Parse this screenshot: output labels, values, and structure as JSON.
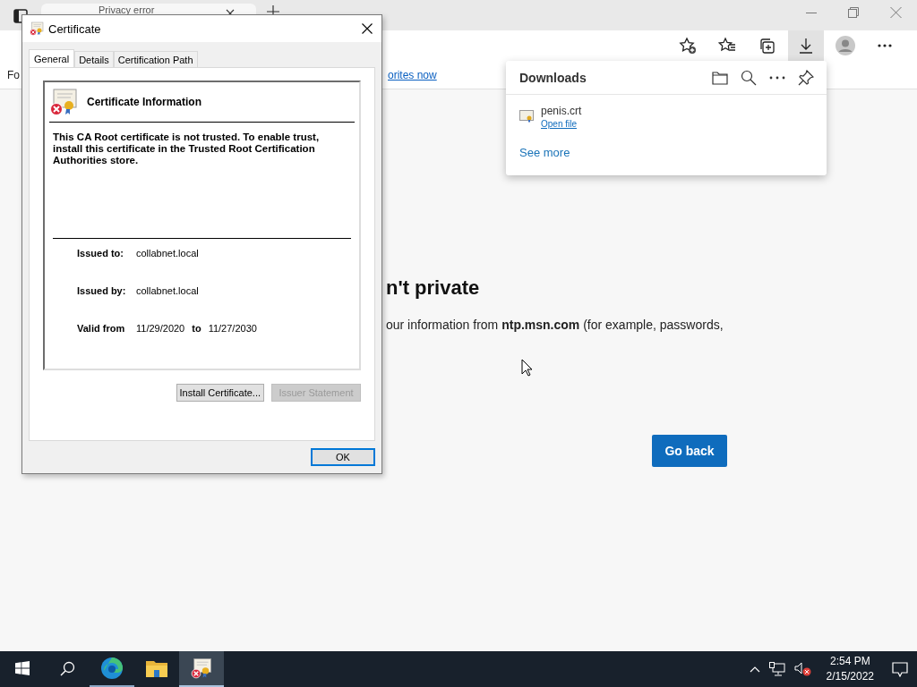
{
  "browser": {
    "tab": {
      "title": "Privacy error"
    },
    "toolbar_buttons": [
      {
        "kind": "add-favorite",
        "selected": false
      },
      {
        "kind": "favorites",
        "selected": false
      },
      {
        "kind": "collections",
        "selected": false
      },
      {
        "kind": "downloads",
        "selected": true
      },
      {
        "kind": "profile",
        "selected": false
      },
      {
        "kind": "more",
        "selected": false
      }
    ],
    "favorites_bar": {
      "text": "Fo",
      "link": "orites now"
    },
    "page": {
      "heading": "n't private",
      "message": "our information from **ntp.msn.com** (for example, passwords,",
      "button": "Go back"
    }
  },
  "downloads_panel": {
    "title": "Downloads",
    "items": [
      {
        "file": "penis.crt",
        "action": "Open file"
      }
    ],
    "see_more": "See more"
  },
  "certificate_dialog": {
    "title": "Certificate",
    "tabs": [
      {
        "label": "General",
        "selected": true
      },
      {
        "label": "Details",
        "selected": false
      },
      {
        "label": "Certification Path",
        "selected": false
      }
    ],
    "heading": "Certificate Information",
    "message": "This CA Root certificate is not trusted. To enable trust, install this certificate in the Trusted Root Certification Authorities store.",
    "fields": [
      {
        "label": "Issued to:",
        "value": "collabnet.local"
      },
      {
        "label": "Issued by:",
        "value": "collabnet.local"
      }
    ],
    "validity": {
      "label": "Valid from",
      "from": "11/29/2020",
      "to_label": "to",
      "to": "11/27/2030"
    },
    "buttons": [
      {
        "label": "Install Certificate...",
        "disabled": false
      },
      {
        "label": "Issuer Statement",
        "disabled": true
      }
    ],
    "ok": "OK"
  },
  "taskbar": {
    "apps": [
      {
        "kind": "edge",
        "running": true,
        "selected": false
      },
      {
        "kind": "explorer",
        "running": false,
        "selected": false
      },
      {
        "kind": "certificate",
        "running": true,
        "selected": true
      }
    ],
    "time": "2:54 PM",
    "date": "2/15/2022"
  }
}
